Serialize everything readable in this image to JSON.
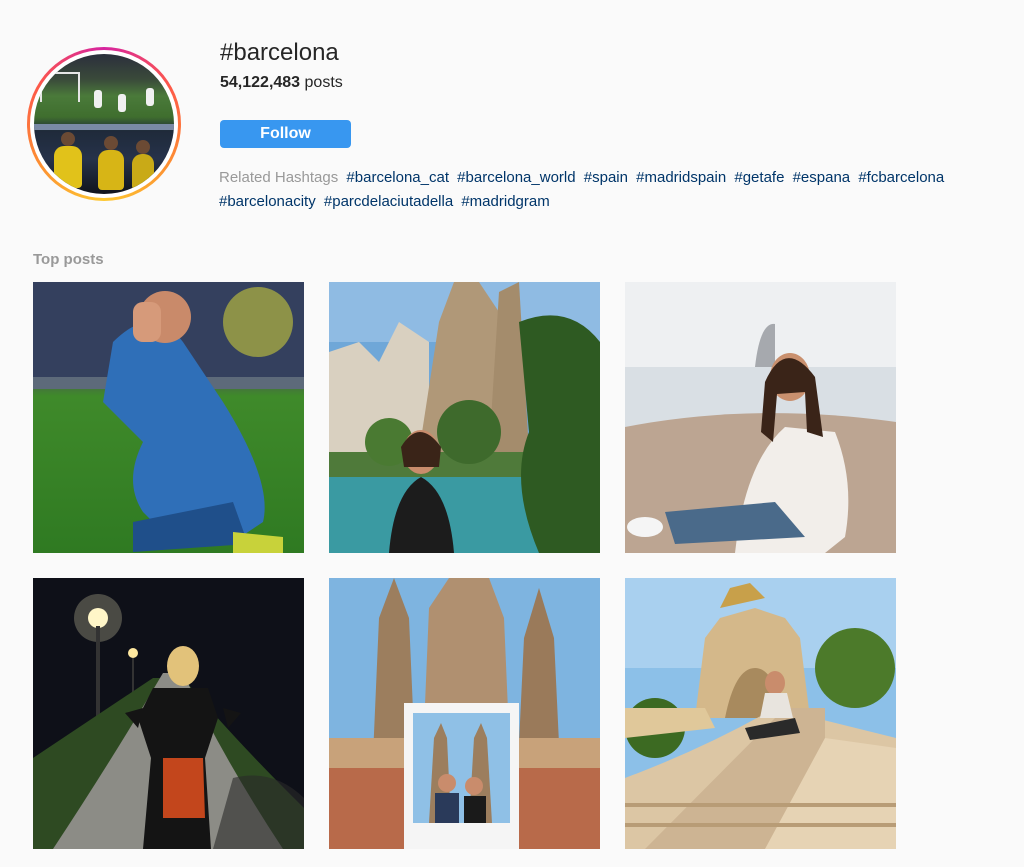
{
  "hashtag": {
    "title": "#barcelona",
    "posts_count": "54,122,483",
    "posts_label": "posts",
    "avatar_icon": "profile-image",
    "follow_label": "Follow"
  },
  "related": {
    "label": "Related Hashtags",
    "tags": [
      "#barcelona_cat",
      "#barcelona_world",
      "#spain",
      "#madridspain",
      "#getafe",
      "#espana",
      "#fcbarcelona",
      "#barcelonacity",
      "#parcdelaciutadella",
      "#madridgram"
    ]
  },
  "top_posts": {
    "title": "Top posts"
  },
  "colors": {
    "accent": "#3897f0",
    "link": "#003569",
    "muted": "#999999",
    "background": "#fafafa"
  }
}
